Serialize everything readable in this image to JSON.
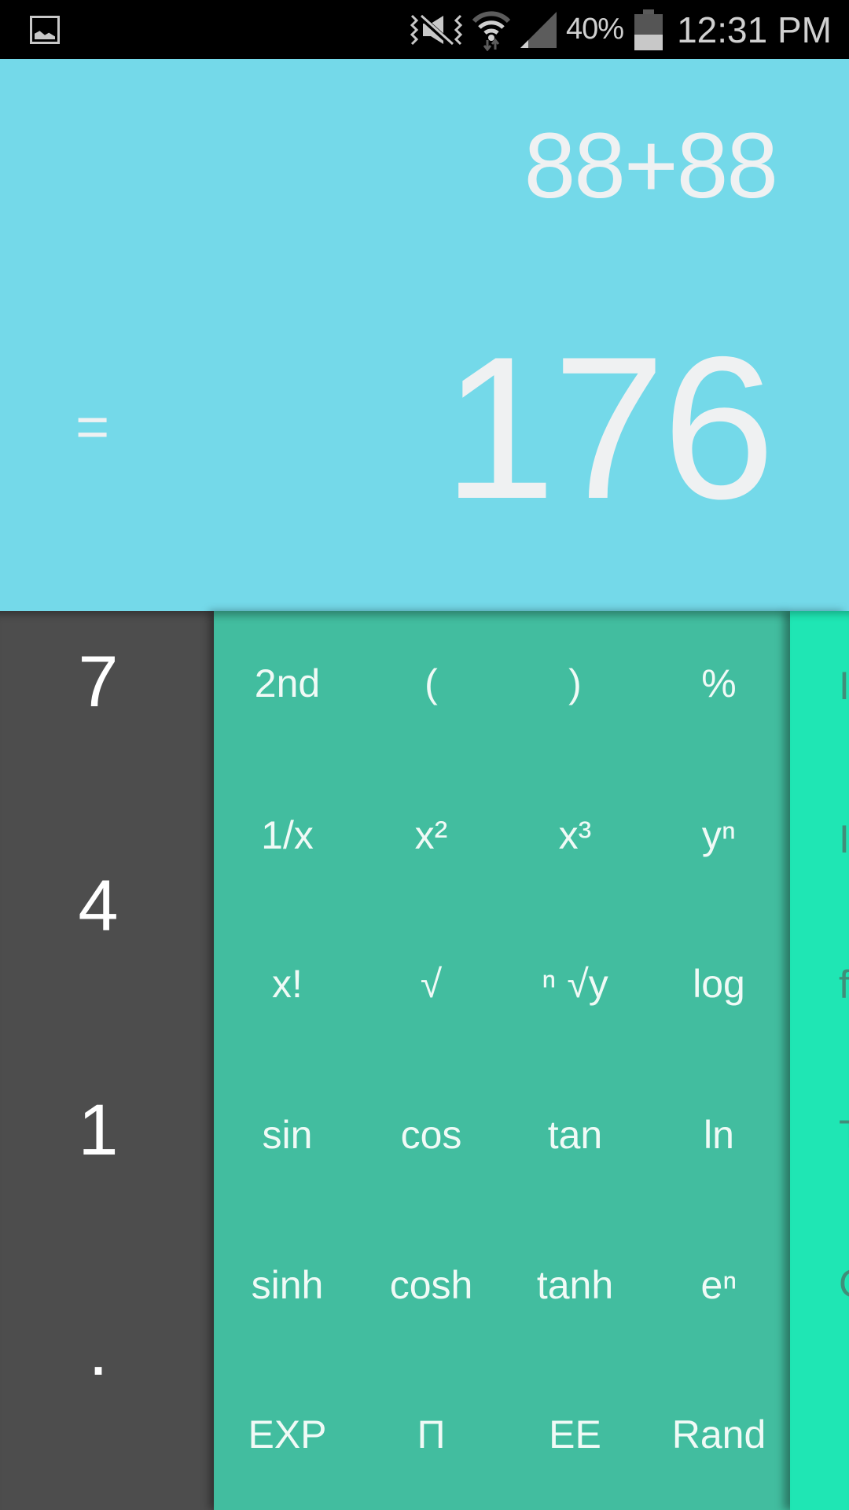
{
  "status_bar": {
    "notification_icon": "gallery-icon",
    "icons": [
      "vibrate-mute-icon",
      "wifi-icon",
      "signal-icon"
    ],
    "battery_percent": "40%",
    "battery_level": 0.4,
    "time": "12:31 PM"
  },
  "display": {
    "expression": "88+88",
    "equals": "=",
    "result": "176"
  },
  "numpad": {
    "keys": [
      "7",
      "4",
      "1",
      "."
    ]
  },
  "advanced_panel": {
    "rows": [
      [
        "2nd",
        "(",
        ")",
        "%"
      ],
      [
        "1/x",
        "x²",
        "x³",
        "yⁿ"
      ],
      [
        "x!",
        "√",
        "ⁿ √y",
        "log"
      ],
      [
        "sin",
        "cos",
        "tan",
        "ln"
      ],
      [
        "sinh",
        "cosh",
        "tanh",
        "eⁿ"
      ],
      [
        "EXP",
        "Π",
        "EE",
        "Rand"
      ]
    ]
  },
  "edge_panel": {
    "partial_keys": [
      "I",
      "I",
      "f",
      "T",
      "G"
    ]
  },
  "colors": {
    "display_bg": "#74D9E9",
    "display_text": "#EFF1F2",
    "numpad_bg": "#4D4D4D",
    "advanced_bg": "#42BD9F",
    "edge_bg": "#1FE6B4"
  }
}
